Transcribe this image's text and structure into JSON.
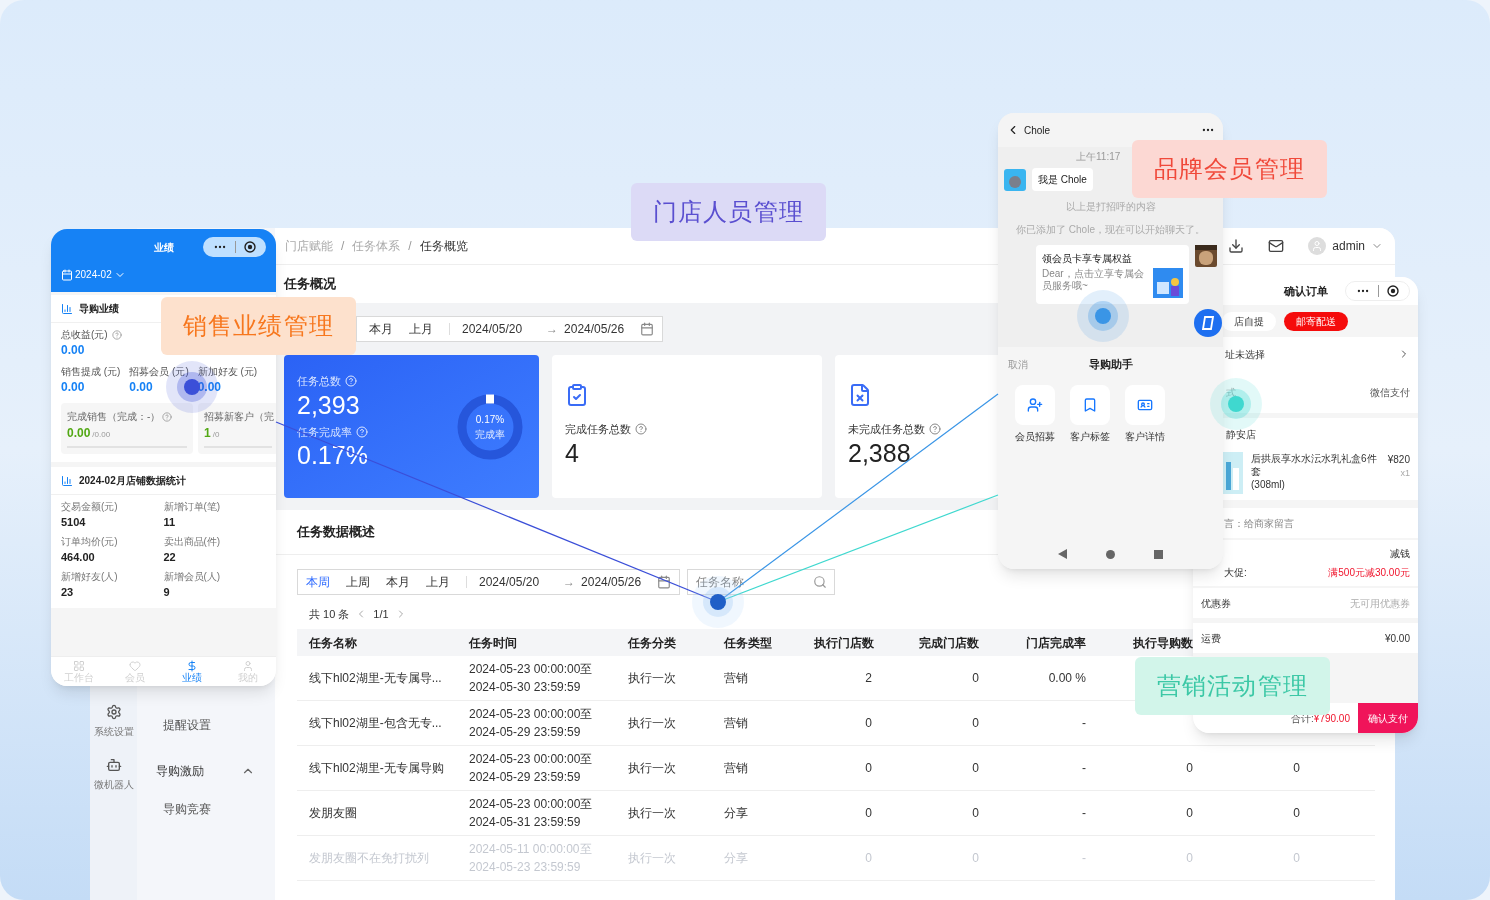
{
  "labels": [
    {
      "text": "门店人员管理",
      "color": "#5a4fd0",
      "kind": "staff"
    },
    {
      "text": "品牌会员管理",
      "color": "#f0493a",
      "kind": "member"
    },
    {
      "text": "销售业绩管理",
      "color": "#f7771e",
      "kind": "sales"
    },
    {
      "text": "营销活动管理",
      "color": "#3cc8a6",
      "kind": "marketing"
    }
  ],
  "dashboard": {
    "breadcrumb": [
      "门店赋能",
      "任务体系",
      "任务概览"
    ],
    "breadcrumb_separator": "/",
    "user": "admin",
    "page_title": "任务概况",
    "overview_filter": {
      "tabs": [
        {
          "label": "本月",
          "selected": false
        },
        {
          "label": "上月",
          "selected": false
        }
      ],
      "start": "2024/05/20",
      "arrow": "→",
      "end": "2024/05/26"
    },
    "summary": {
      "total_label": "任务总数",
      "total": "2,393",
      "rate_label": "任务完成率",
      "rate": "0.17%",
      "ring_value": "0.17%",
      "ring_label": "完成率"
    },
    "stat_cards": [
      {
        "kind": "done",
        "label": "完成任务总数",
        "value": "4"
      },
      {
        "kind": "undone",
        "label": "未完成任务总数",
        "value": "2,388"
      }
    ],
    "section_title": "任务数据概述",
    "filter": {
      "tabs": [
        {
          "label": "本周",
          "selected": true
        },
        {
          "label": "上周",
          "selected": false
        },
        {
          "label": "本月",
          "selected": false
        },
        {
          "label": "上月",
          "selected": false
        }
      ],
      "start": "2024/05/20",
      "arrow": "→",
      "end": "2024/05/26",
      "search_placeholder": "任务名称"
    },
    "pagination": {
      "total": "共 10 条",
      "page": "1/1"
    },
    "table": {
      "columns": [
        "任务名称",
        "任务时间",
        "任务分类",
        "任务类型",
        "执行门店数",
        "完成门店数",
        "门店完成率",
        "执行导购数"
      ],
      "rows": [
        {
          "faded": false,
          "cells": [
            "线下hl02湖里-无专属导...",
            "2024-05-23 00:00:00至\n2024-05-30 23:59:59",
            "执行一次",
            "营销",
            "2",
            "0",
            "0.00 %"
          ]
        },
        {
          "faded": false,
          "cells": [
            "线下hl02湖里-包含无专...",
            "2024-05-23 00:00:00至\n2024-05-29 23:59:59",
            "执行一次",
            "营销",
            "0",
            "0",
            "-"
          ]
        },
        {
          "faded": false,
          "cells": [
            "线下hl02湖里-无专属导购",
            "2024-05-23 00:00:00至\n2024-05-29 23:59:59",
            "执行一次",
            "营销",
            "0",
            "0",
            "-",
            "0",
            "0"
          ]
        },
        {
          "faded": false,
          "cells": [
            "发朋友圈",
            "2024-05-23 00:00:00至\n2024-05-31 23:59:59",
            "执行一次",
            "分享",
            "0",
            "0",
            "-",
            "0",
            "0"
          ]
        },
        {
          "faded": true,
          "cells": [
            "发朋友圈不在免打扰列",
            "2024-05-11 00:00:00至\n2024-05-23 23:59:59",
            "执行一次",
            "分享",
            "0",
            "0",
            "-",
            "0",
            "0"
          ]
        }
      ]
    },
    "sidebar": {
      "nav": [
        {
          "kind": "gear",
          "label": "系统设置"
        },
        {
          "kind": "robot",
          "label": "微机器人"
        }
      ],
      "submenu": [
        {
          "kind": "item",
          "label": "提醒设置"
        },
        {
          "kind": "group",
          "label": "导购激励",
          "expanded": true
        },
        {
          "kind": "item",
          "label": "导购竞赛"
        }
      ]
    }
  },
  "sales_phone": {
    "title": "业绩",
    "month": "2024-02",
    "section_title": "导购业绩",
    "total_label": "总收益(元)",
    "total": "0.00",
    "metrics": [
      {
        "label": "销售提成 (元)",
        "value": "0.00"
      },
      {
        "label": "招募会员 (元)",
        "value": "0.00"
      },
      {
        "label": "新加好友 (元)",
        "value": "0.00"
      }
    ],
    "progress_cards": [
      {
        "label": "完成销售（完成：-）",
        "value": "0.00",
        "target": "/0.00"
      },
      {
        "label": "招募新客户（完",
        "value": "1",
        "target": "/0"
      }
    ],
    "stats_title": "2024-02月店铺数据统计",
    "stats": [
      {
        "label": "交易金额(元)",
        "value": "5104"
      },
      {
        "label": "新增订单(笔)",
        "value": "11"
      },
      {
        "label": "订单均价(元)",
        "value": "464.00"
      },
      {
        "label": "卖出商品(件)",
        "value": "22"
      },
      {
        "label": "新增好友(人)",
        "value": "23"
      },
      {
        "label": "新增会员(人)",
        "value": "9"
      }
    ],
    "tabs": [
      {
        "kind": "desk",
        "label": "工作台",
        "selected": false
      },
      {
        "kind": "member",
        "label": "会员",
        "selected": false
      },
      {
        "kind": "sales",
        "label": "业绩",
        "selected": true
      },
      {
        "kind": "me",
        "label": "我的",
        "selected": false
      }
    ]
  },
  "chat_phone": {
    "contact": "Chole",
    "time": "上午11:17",
    "message": "我是 Chole",
    "notes": [
      "以上是打招呼的内容",
      "你已添加了 Chole，现在可以开始聊天了。"
    ],
    "card": {
      "title": "领会员卡享专属权益",
      "desc": "Dear，点击立享专属会员服务哦~"
    },
    "sheet": {
      "cancel": "取消",
      "title": "导购助手",
      "actions": [
        {
          "kind": "member",
          "label": "会员招募"
        },
        {
          "kind": "tag",
          "label": "客户标签"
        },
        {
          "kind": "profile",
          "label": "客户详情"
        }
      ]
    }
  },
  "order_phone": {
    "title": "确认订单",
    "delivery": [
      {
        "label": "店自提",
        "selected": false
      },
      {
        "label": "邮寄配送",
        "selected": true
      }
    ],
    "address": "址未选择",
    "pay_label": "式",
    "pay_value": "微信支付",
    "store": "静安店",
    "product": {
      "name": "后拱辰享水水沄水乳礼盒6件套\n(308ml)",
      "price": "¥820",
      "qty": "x1"
    },
    "note": "言：给商家留言",
    "discount_title": "减钱",
    "promo_label": "大促:",
    "promo_value": "满500元减30.00元",
    "coupon_label": "优惠券",
    "coupon_value": "无可用优惠券",
    "shipping_label": "运费",
    "shipping_value": "¥0.00",
    "total_label": "合计:",
    "total": "¥790.00",
    "pay_button": "确认支付"
  }
}
